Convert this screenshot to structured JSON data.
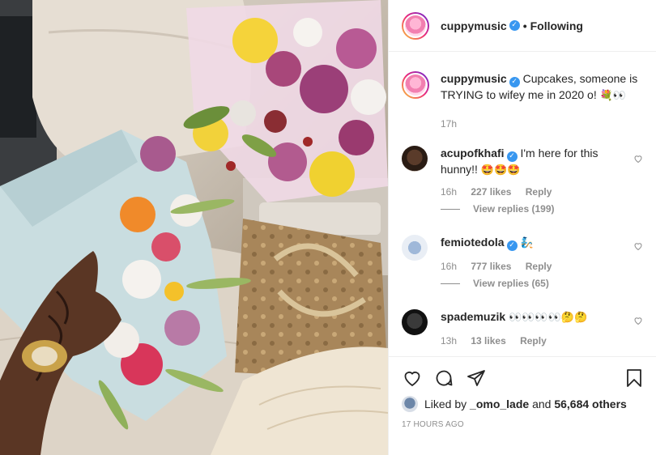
{
  "header": {
    "username": "cuppymusic",
    "separator": "•",
    "follow_status": "Following"
  },
  "caption": {
    "username": "cuppymusic",
    "text": "Cupcakes, someone is TRYING to wifey me in 2020 o!",
    "emoji": "💐👀",
    "time": "17h"
  },
  "comments": [
    {
      "username": "acupofkhafi",
      "text": "I'm here for this hunny!!",
      "emoji": "🤩🤩🤩",
      "time": "16h",
      "likes": "227 likes",
      "reply": "Reply",
      "view_replies": "View replies (199)"
    },
    {
      "username": "femiotedola",
      "text": "",
      "emoji": "🧞",
      "time": "16h",
      "likes": "777 likes",
      "reply": "Reply",
      "view_replies": "View replies (65)"
    },
    {
      "username": "spademuzik",
      "text": "",
      "emoji": "👀👀👀👀🤔🤔",
      "time": "13h",
      "likes": "13 likes",
      "reply": "Reply",
      "view_replies": ""
    }
  ],
  "likes": {
    "prefix": "Liked by",
    "user": "_omo_lade",
    "middle": "and",
    "others": "56,684 others"
  },
  "posted_ago": "17 HOURS AGO",
  "icons": {
    "like": "heart-icon",
    "comment": "comment-icon",
    "share": "share-icon",
    "save": "bookmark-icon"
  }
}
